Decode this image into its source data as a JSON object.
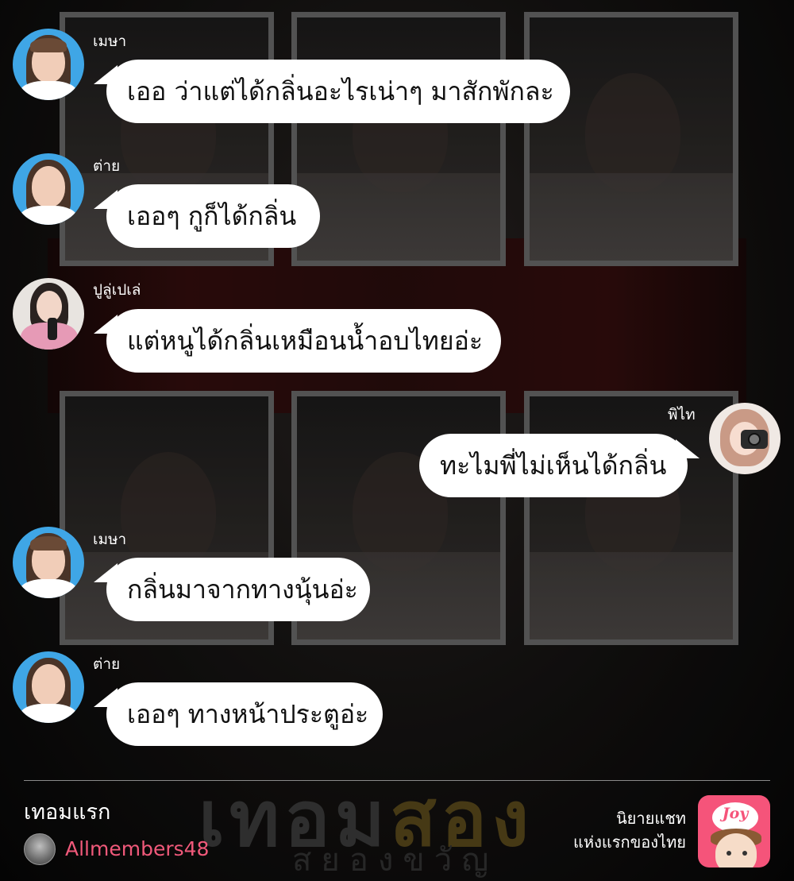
{
  "background": {
    "title_part1": "เทอม",
    "title_part2": "สอง",
    "subtitle": "สยองขวัญ"
  },
  "messages": [
    {
      "sender": "เมษา",
      "text": "เออ ว่าแต่ได้กลิ่นอะไรเน่าๆ มาสักพักละ",
      "side": "left",
      "avatar": "avatar-mesa"
    },
    {
      "sender": "ต่าย",
      "text": "เออๆ กูก็ได้กลิ่น",
      "side": "left",
      "avatar": "avatar-tai"
    },
    {
      "sender": "ปูลู่เปเล่",
      "text": "แต่หนูได้กลิ่นเหมือนน้ำอบไทยอ่ะ",
      "side": "left",
      "avatar": "avatar-pulupele"
    },
    {
      "sender": "พิไท",
      "text": "ทะไมพี่ไม่เห็นได้กลิ่น",
      "side": "right",
      "avatar": "avatar-pitai"
    },
    {
      "sender": "เมษา",
      "text": "กลิ่นมาจากทางนุ้นอ่ะ",
      "side": "left",
      "avatar": "avatar-mesa"
    },
    {
      "sender": "ต่าย",
      "text": "เออๆ ทางหน้าประตูอ่ะ",
      "side": "left",
      "avatar": "avatar-tai"
    }
  ],
  "footer": {
    "story_title": "เทอมแรก",
    "author": "Allmembers48",
    "promo_line1": "นิยายแชท",
    "promo_line2": "แห่งแรกของไทย",
    "logo_text": "Joy"
  },
  "colors": {
    "bubble": "#ffffff",
    "author": "#f0597a",
    "logo": "#f5547a"
  }
}
